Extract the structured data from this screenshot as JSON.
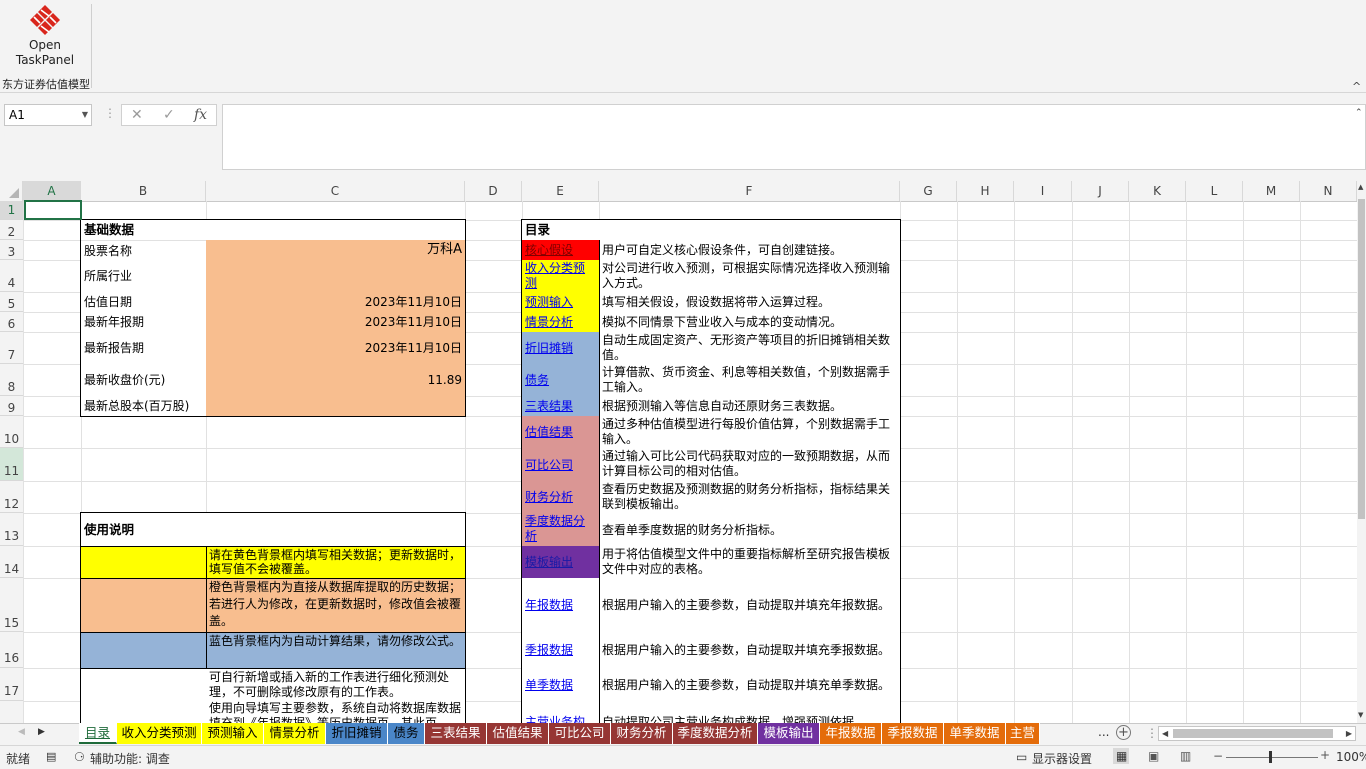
{
  "ribbon": {
    "open_button": {
      "line1": "Open",
      "line2": "TaskPanel"
    },
    "group_label": "东方证券估值模型",
    "collapse": "^"
  },
  "formula_bar": {
    "name_box": "A1",
    "cancel": "✕",
    "enter": "✓",
    "fx": "fx",
    "value": ""
  },
  "columns": [
    "A",
    "B",
    "C",
    "D",
    "E",
    "F",
    "G",
    "H",
    "I",
    "J",
    "K",
    "L",
    "M",
    "N"
  ],
  "rows": [
    "1",
    "2",
    "3",
    "4",
    "5",
    "6",
    "7",
    "8",
    "9",
    "10",
    "11",
    "12",
    "13",
    "14",
    "15",
    "16",
    "17"
  ],
  "basic_data": {
    "title": "基础数据",
    "rows": [
      {
        "label": "股票名称",
        "value": "万科A"
      },
      {
        "label": "所属行业",
        "value": ""
      },
      {
        "label": "估值日期",
        "value": "2023年11月10日"
      },
      {
        "label": "最新年报期",
        "value": "2023年11月10日"
      },
      {
        "label": "最新报告期",
        "value": "2023年11月10日"
      },
      {
        "label": "最新收盘价(元)",
        "value": "11.89"
      },
      {
        "label": "最新总股本(百万股)",
        "value": ""
      }
    ]
  },
  "instructions": {
    "title": "使用说明",
    "items": [
      {
        "color": "#ffff00",
        "text": "请在黄色背景框内填写相关数据；更新数据时，填写值不会被覆盖。"
      },
      {
        "color": "#f8be8f",
        "text": "橙色背景框内为直接从数据库提取的历史数据；若进行人为修改，在更新数据时，修改值会被覆盖。"
      },
      {
        "color": "#95b3d7",
        "text": " 蓝色背景框内为自动计算结果，请勿修改公式。"
      },
      {
        "color": "#ffffff",
        "text": "可自行新增或插入新的工作表进行细化预测处理，不可删除或修改原有的工作表。"
      },
      {
        "color": "#ffffff",
        "text": "使用向导填写主要参数，系统自动将数据库数据填充到《年报数据》等历史数据页，其此页"
      }
    ]
  },
  "toc": {
    "title": "目录",
    "items": [
      {
        "name": "核心假设",
        "bg": "#ff0000",
        "desc": "用户可自定义核心假设条件，可自创建链接。"
      },
      {
        "name": "收入分类预测",
        "bg": "#ffff00",
        "desc": "对公司进行收入预测，可根据实际情况选择收入预测输入方式。"
      },
      {
        "name": "预测输入",
        "bg": "#ffff00",
        "desc": "填写相关假设，假设数据将带入运算过程。"
      },
      {
        "name": "情景分析",
        "bg": "#ffff00",
        "desc": "模拟不同情景下营业收入与成本的变动情况。"
      },
      {
        "name": "折旧摊销",
        "bg": "#95b3d7",
        "desc": "自动生成固定资产、无形资产等项目的折旧摊销相关数值。"
      },
      {
        "name": "债务",
        "bg": "#95b3d7",
        "desc": "计算借款、货币资金、利息等相关数值，个别数据需手工输入。"
      },
      {
        "name": "三表结果",
        "bg": "#95b3d7",
        "desc": "根据预测输入等信息自动还原财务三表数据。"
      },
      {
        "name": "估值结果",
        "bg": "#da9694",
        "desc": "通过多种估值模型进行每股价值估算，个别数据需手工输入。"
      },
      {
        "name": "可比公司",
        "bg": "#da9694",
        "desc": "通过输入可比公司代码获取对应的一致预期数据，从而计算目标公司的相对估值。"
      },
      {
        "name": "财务分析",
        "bg": "#da9694",
        "desc": "查看历史数据及预测数据的财务分析指标，指标结果关联到模板输出。"
      },
      {
        "name": "季度数据分析",
        "bg": "#da9694",
        "desc": "查看单季度数据的财务分析指标。"
      },
      {
        "name": "模板输出",
        "bg": "#7030a0",
        "desc": "用于将估值模型文件中的重要指标解析至研究报告模板文件中对应的表格。"
      },
      {
        "name": "年报数据",
        "bg": "#ffffff",
        "desc": "根据用户输入的主要参数，自动提取并填充年报数据。"
      },
      {
        "name": "季报数据",
        "bg": "#ffffff",
        "desc": "根据用户输入的主要参数，自动提取并填充季报数据。"
      },
      {
        "name": "单季数据",
        "bg": "#ffffff",
        "desc": "根据用户输入的主要参数，自动提取并填充单季数据。"
      },
      {
        "name": "主营业务构成",
        "bg": "#ffffff",
        "desc": "自动提取公司主营业务构成数据，增强预测依据。"
      }
    ]
  },
  "tabs": [
    {
      "label": "目录",
      "bg": "#ffffff",
      "fg": "#1f6b3a",
      "active": true
    },
    {
      "label": "收入分类预测",
      "bg": "#ffff00",
      "fg": "#000000"
    },
    {
      "label": "预测输入",
      "bg": "#ffff00",
      "fg": "#000000"
    },
    {
      "label": "情景分析",
      "bg": "#ffff00",
      "fg": "#000000"
    },
    {
      "label": "折旧摊销",
      "bg": "#4a86c8",
      "fg": "#000000"
    },
    {
      "label": "债务",
      "bg": "#4a86c8",
      "fg": "#000000"
    },
    {
      "label": "三表结果",
      "bg": "#963634",
      "fg": "#ffffff"
    },
    {
      "label": "估值结果",
      "bg": "#963634",
      "fg": "#ffffff"
    },
    {
      "label": "可比公司",
      "bg": "#963634",
      "fg": "#ffffff"
    },
    {
      "label": "财务分析",
      "bg": "#963634",
      "fg": "#ffffff"
    },
    {
      "label": "季度数据分析",
      "bg": "#963634",
      "fg": "#ffffff"
    },
    {
      "label": "模板输出",
      "bg": "#7030a0",
      "fg": "#ffffff"
    },
    {
      "label": "年报数据",
      "bg": "#e46c0a",
      "fg": "#ffffff"
    },
    {
      "label": "季报数据",
      "bg": "#e46c0a",
      "fg": "#ffffff"
    },
    {
      "label": "单季数据",
      "bg": "#e46c0a",
      "fg": "#ffffff"
    },
    {
      "label": "主营",
      "bg": "#e46c0a",
      "fg": "#ffffff"
    }
  ],
  "tab_more": "...",
  "status": {
    "ready": "就绪",
    "accessibility": "辅助功能: 调查",
    "display_settings": "显示器设置",
    "zoom": "100%"
  }
}
